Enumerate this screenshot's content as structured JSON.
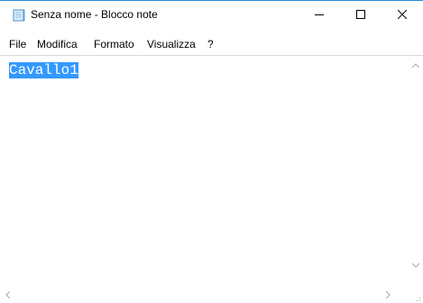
{
  "window": {
    "title": "Senza nome - Blocco note",
    "app_icon": "notepad-icon",
    "controls": {
      "minimize_icon": "minimize-icon",
      "maximize_icon": "maximize-icon",
      "close_icon": "close-icon"
    },
    "accent_color": "#2b8bd6"
  },
  "menu": {
    "items": [
      {
        "label": "File"
      },
      {
        "label": "Modifica"
      },
      {
        "label": "Formato"
      },
      {
        "label": "Visualizza"
      },
      {
        "label": "?"
      }
    ]
  },
  "editor": {
    "content": "Cavallo1",
    "selection_color": "#3399ff"
  }
}
